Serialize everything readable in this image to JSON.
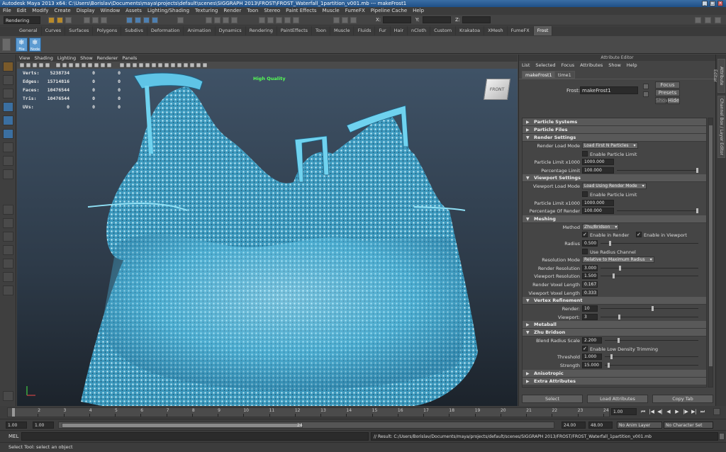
{
  "window": {
    "title": "Autodesk Maya 2013 x64: C:\\Users\\Borislav\\Documents\\maya\\projects\\default\\scenes\\SIGGRAPH 2013\\FROST\\FROST_Waterfall_1partition_v001.mb    ---    makeFrost1"
  },
  "menubar": [
    "File",
    "Edit",
    "Modify",
    "Create",
    "Display",
    "Window",
    "Assets",
    "Lighting/Shading",
    "Texturing",
    "Render",
    "Toon",
    "Stereo",
    "Paint Effects",
    "Muscle",
    "FumeFX",
    "Pipeline Cache",
    "Help"
  ],
  "status": {
    "mode": "Rendering",
    "x_label": "X:",
    "y_label": "Y:",
    "z_label": "Z:"
  },
  "shelf_tabs": [
    "General",
    "Curves",
    "Surfaces",
    "Polygons",
    "Subdivs",
    "Deformation",
    "Animation",
    "Dynamics",
    "Rendering",
    "PaintEffects",
    "Toon",
    "Muscle",
    "Fluids",
    "Fur",
    "Hair",
    "nCloth",
    "Custom",
    "Krakatoa",
    "XMesh",
    "FumeFX",
    "Frost"
  ],
  "active_shelf": "Frost",
  "shelf_buttons": [
    "File",
    "Node"
  ],
  "viewport": {
    "menu": [
      "View",
      "Shading",
      "Lighting",
      "Show",
      "Renderer",
      "Panels"
    ],
    "hud": [
      {
        "label": "Verts:",
        "values": [
          "5238734",
          "0",
          "0"
        ]
      },
      {
        "label": "Edges:",
        "values": [
          "15714816",
          "0",
          "0"
        ]
      },
      {
        "label": "Faces:",
        "values": [
          "10476544",
          "0",
          "0"
        ]
      },
      {
        "label": "Tris:",
        "values": [
          "10476544",
          "0",
          "0"
        ]
      },
      {
        "label": "UVs:",
        "values": [
          "0",
          "0",
          "0"
        ]
      }
    ],
    "quality_label": "High Quality",
    "viewcube": "FRONT"
  },
  "attr": {
    "title": "Attribute Editor",
    "menu": [
      "List",
      "Selected",
      "Focus",
      "Attributes",
      "Show",
      "Help"
    ],
    "tabs": [
      "makeFrost1",
      "time1"
    ],
    "node_label": "Frost:",
    "node_value": "makeFrost1",
    "focus": "Focus",
    "presets": "Presets",
    "show": "Show",
    "hide": "Hide",
    "sec_particle_systems": "Particle Systems",
    "sec_particle_files": "Particle Files",
    "sec_render": "Render Settings",
    "render_load_mode_label": "Render Load Mode",
    "render_load_mode": "Load First N Particles",
    "enable_particle_limit": "Enable Particle Limit",
    "particle_limit_label": "Particle Limit x1000",
    "particle_limit": "1000.000",
    "percentage_limit_label": "Percentage Limit",
    "percentage_limit": "100.000",
    "sec_viewport": "Viewport Settings",
    "viewport_load_mode_label": "Viewport Load Mode",
    "viewport_load_mode": "Load Using Render Mode",
    "vp_enable_particle_limit": "Enable Particle Limit",
    "vp_particle_limit_label": "Particle Limit x1000",
    "vp_particle_limit": "1000.000",
    "pct_of_render_label": "Percentage Of Render",
    "pct_of_render": "100.000",
    "sec_meshing": "Meshing",
    "method_label": "Method",
    "method": "Zhu/Bridson",
    "enable_in_render": "Enable in Render",
    "enable_in_viewport": "Enable in Viewport",
    "radius_label": "Radius",
    "radius": "0.500",
    "use_radius_channel": "Use Radius Channel",
    "res_mode_label": "Resolution Mode",
    "res_mode": "Relative to Maximum Radius",
    "render_res_label": "Render Resolution",
    "render_res": "3.000",
    "vp_res_label": "Viewport Resolution",
    "vp_res": "1.500",
    "render_voxel_label": "Render Voxel Length",
    "render_voxel": "0.167",
    "vp_voxel_label": "Viewport Voxel Length",
    "vp_voxel": "0.333",
    "sec_vertex": "Vertex Refinement",
    "vr_render_label": "Render:",
    "vr_render": "10",
    "vr_viewport_label": "Viewport:",
    "vr_viewport": "3",
    "sec_metaball": "Metaball",
    "sec_zhu": "Zhu Bridson",
    "blend_label": "Blend Radius Scale",
    "blend": "2.200",
    "low_density": "Enable Low Density Trimming",
    "threshold_label": "Threshold",
    "threshold": "1.000",
    "strength_label": "Strength",
    "strength": "15.000",
    "sec_anisotropic": "Anisotropic",
    "sec_extra": "Extra Attributes",
    "btn_select": "Select",
    "btn_load": "Load Attributes",
    "btn_copy": "Copy Tab"
  },
  "side_tabs": [
    "Attribute Editor",
    "Channel Box / Layer Editor"
  ],
  "timeline": {
    "ticks": [
      "1",
      "2",
      "3",
      "4",
      "5",
      "6",
      "7",
      "8",
      "9",
      "10",
      "11",
      "12",
      "13",
      "14",
      "15",
      "16",
      "17",
      "18",
      "19",
      "20",
      "21",
      "22",
      "23",
      "24"
    ],
    "current_frame": "1.00"
  },
  "range": {
    "start": "1.00",
    "inner_start": "1.00",
    "inner_value": "1",
    "range_end": "24",
    "end": "24.00",
    "max": "48.00",
    "anim_layer": "No Anim Layer",
    "char_set": "No Character Set"
  },
  "cmd": {
    "label": "MEL",
    "result": "// Result: C:/Users/Borislav/Documents/maya/projects/default/scenes/SIGGRAPH 2013/FROST/FROST_Waterfall_1partition_v001.mb"
  },
  "help": "Select Tool: select an object",
  "colors": {
    "accent": "#5d9bd1",
    "water": "#7fd8f0"
  }
}
